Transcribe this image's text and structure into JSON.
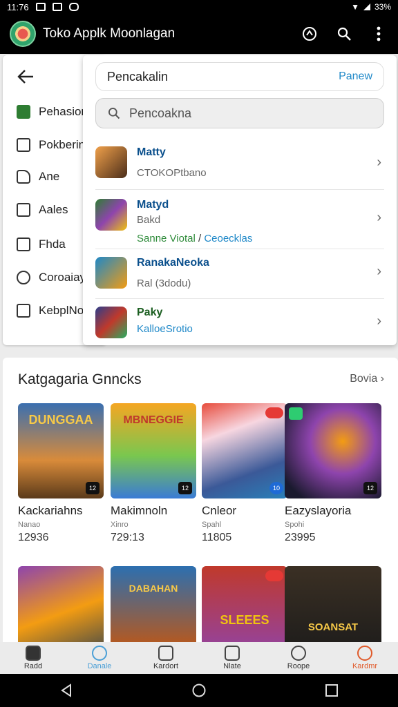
{
  "status": {
    "time": "11:76",
    "battery": "33%"
  },
  "appbar": {
    "title": "Toko Applk Moonlagan"
  },
  "drawer": {
    "items": [
      {
        "label": "Pehasion"
      },
      {
        "label": "Pokberin"
      },
      {
        "label": "Ane"
      },
      {
        "label": "Aales"
      },
      {
        "label": "Fhda"
      },
      {
        "label": "Coroaiay"
      },
      {
        "label": "KebplNo"
      }
    ]
  },
  "search_panel": {
    "header_title": "Pencakalin",
    "header_action": "Panew",
    "placeholder": "Pencoakna",
    "results": [
      {
        "name": "Matty",
        "sub": "CTOKOPtbano",
        "extra": "",
        "extra2": ""
      },
      {
        "name": "Matyd",
        "sub": "Bakd",
        "extra": "Sanne Viotal",
        "extra2": "Ceoecklas"
      },
      {
        "name": "RanakaNeoka",
        "sub": "Ral (3dodu)",
        "extra": "",
        "extra2": ""
      },
      {
        "name": "Paky",
        "sub": "KalloeSrotio",
        "extra": "",
        "extra2": ""
      }
    ]
  },
  "section": {
    "title": "Katgagaria Gnncks",
    "more": "Bovia",
    "cards": [
      {
        "title": "Kackariahns",
        "sub": "Nanao",
        "count": "12936",
        "art": "DUNGGAA",
        "badge": "12"
      },
      {
        "title": "Makimnoln",
        "sub": "Xinro",
        "count": "729:13",
        "art": "MBNEGGIE",
        "badge": "12"
      },
      {
        "title": "Cnleor",
        "sub": "Spahl",
        "count": "11805",
        "art": "",
        "badge": "10"
      },
      {
        "title": "Eazyslayoria",
        "sub": "Spohi",
        "count": "23995",
        "art": "",
        "badge": "12"
      },
      {
        "title": "",
        "sub": "",
        "count": "",
        "art": "",
        "badge": ""
      },
      {
        "title": "",
        "sub": "",
        "count": "",
        "art": "DABAHAN",
        "badge": ""
      },
      {
        "title": "",
        "sub": "",
        "count": "",
        "art": "SLEEES",
        "badge": ""
      },
      {
        "title": "",
        "sub": "",
        "count": "",
        "art": "SOANSAT",
        "badge": ""
      }
    ]
  },
  "bottom_nav": [
    {
      "label": "Radd"
    },
    {
      "label": "Danale"
    },
    {
      "label": "Kardort"
    },
    {
      "label": "Nlate"
    },
    {
      "label": "Roope"
    },
    {
      "label": "Kardmr"
    }
  ],
  "colors": {
    "accent": "#1e88c8",
    "active_nav": "#4a9fd6",
    "alert": "#e05a2a"
  }
}
